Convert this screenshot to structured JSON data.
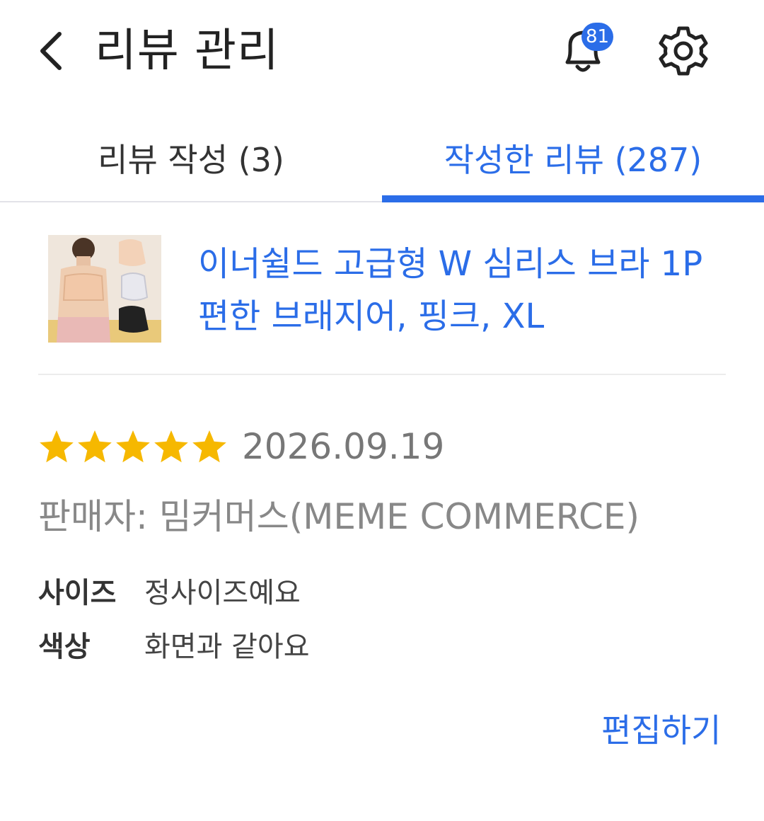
{
  "header": {
    "title": "리뷰 관리",
    "back_icon": "chevron-left-icon",
    "notification_icon": "bell-icon",
    "notification_count": "81",
    "settings_icon": "gear-icon"
  },
  "tabs": [
    {
      "label": "리뷰 작성 (3)",
      "active": false
    },
    {
      "label": "작성한 리뷰 (287)",
      "active": true
    }
  ],
  "review": {
    "product_name": "이너쉴드 고급형 W 심리스 브라 1P 편한 브래지어, 핑크, XL",
    "rating": 5,
    "rating_max": 5,
    "date": "2026.09.19",
    "seller": "판매자: 밈커머스(MEME COMMERCE)",
    "attributes": [
      {
        "label": "사이즈",
        "value": "정사이즈예요"
      },
      {
        "label": "색상",
        "value": "화면과 같아요"
      }
    ],
    "edit_label": "편집하기"
  },
  "colors": {
    "accent": "#2b6de8",
    "star": "#f6b800",
    "muted_text": "#777777"
  }
}
